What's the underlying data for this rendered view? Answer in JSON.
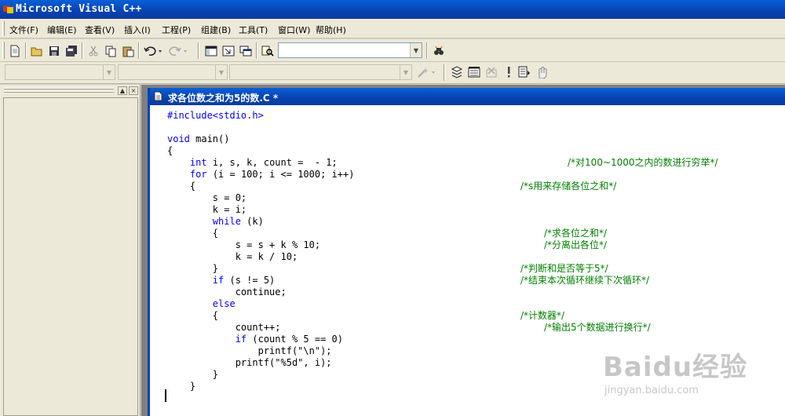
{
  "window": {
    "title": "Microsoft Visual C++",
    "app_icon": "vc-app-icon"
  },
  "menu": [
    {
      "label": "文件(F)"
    },
    {
      "label": "编辑(E)"
    },
    {
      "label": "查看(V)"
    },
    {
      "label": "插入(I)"
    },
    {
      "label": "工程(P)"
    },
    {
      "label": "组建(B)"
    },
    {
      "label": "工具(T)"
    },
    {
      "label": "窗口(W)"
    },
    {
      "label": "帮助(H)"
    }
  ],
  "toolbar1": {
    "icons": [
      "new-file-icon",
      "open-icon",
      "save-icon",
      "save-all-icon",
      "cut-icon",
      "copy-icon",
      "paste-icon",
      "undo-icon",
      "redo-icon",
      "workspace-icon",
      "output-icon",
      "window-list-icon",
      "find-in-files-icon",
      "find-icon"
    ],
    "find_combo": {
      "value": ""
    }
  },
  "toolbar2": {
    "combos": [
      {
        "value": ""
      },
      {
        "value": ""
      },
      {
        "value": ""
      }
    ],
    "icons": [
      "wizard-icon",
      "compile-icon",
      "build-icon",
      "stop-build-icon",
      "execute-icon",
      "go-icon",
      "breakpoint-icon"
    ]
  },
  "document": {
    "title": "求各位数之和为5的数.C *",
    "code": [
      "#include<stdio.h>",
      "",
      "void main()",
      "{",
      "    int i, s, k, count =  - 1;",
      "    for (i = 100; i <= 1000; i++)",
      "    {",
      "        s = 0;",
      "        k = i;",
      "        while (k)",
      "        {",
      "            s = s + k % 10;",
      "            k = k / 10;",
      "        }",
      "        if (s != 5)",
      "            continue;",
      "        else",
      "        {",
      "            count++;",
      "            if (count % 5 == 0)",
      "                printf(\"\\n\");",
      "            printf(\"%5d\", i);",
      "        }",
      "    }"
    ],
    "comments": [
      {
        "line": 5,
        "text": "/*对100~1000之内的数进行穷举*/"
      },
      {
        "line": 7,
        "text": "/*s用来存储各位之和*/"
      },
      {
        "line": 11,
        "text": "/*求各位之和*/"
      },
      {
        "line": 12,
        "text": "/*分离出各位*/"
      },
      {
        "line": 14,
        "text": "/*判断和是否等于5*/"
      },
      {
        "line": 15,
        "text": "/*结束本次循环继续下次循环*/"
      },
      {
        "line": 18,
        "text": "/*计数器*/"
      },
      {
        "line": 19,
        "text": "/*输出5个数据进行换行*/"
      }
    ]
  },
  "watermark": {
    "brand": "Baidu经验",
    "url": "jingyan.baidu.com"
  }
}
